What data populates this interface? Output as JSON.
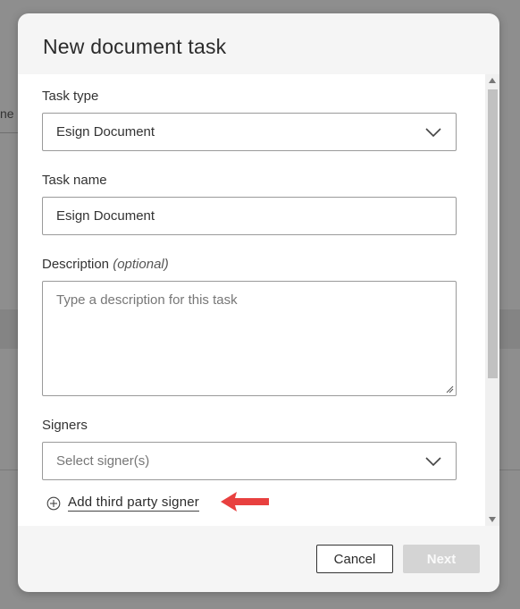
{
  "background": {
    "tab_fragment": "ne"
  },
  "modal": {
    "title": "New document task",
    "task_type": {
      "label": "Task type",
      "value": "Esign Document"
    },
    "task_name": {
      "label": "Task name",
      "value": "Esign Document"
    },
    "description": {
      "label": "Description",
      "optional_label": "(optional)",
      "placeholder": "Type a description for this task"
    },
    "signers": {
      "label": "Signers",
      "placeholder": "Select signer(s)"
    },
    "add_third_party_label": "Add third party signer",
    "buttons": {
      "cancel": "Cancel",
      "next": "Next"
    }
  },
  "colors": {
    "overlay": "#8e8e8e",
    "arrow": "#e8403f",
    "next_disabled": "#d4d4d4",
    "scroll_thumb": "#c1c1c1"
  }
}
